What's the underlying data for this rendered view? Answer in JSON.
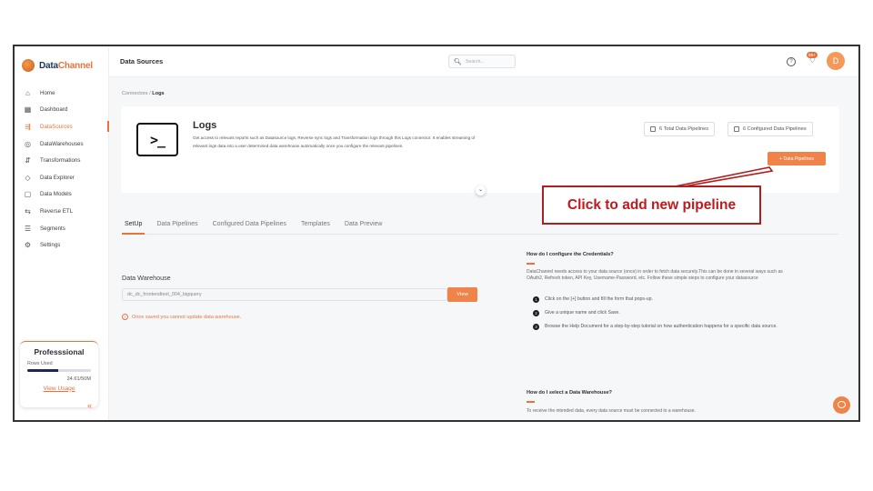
{
  "brand": {
    "name_a": "Data",
    "name_b": "Channel"
  },
  "sidebar": {
    "items": [
      {
        "label": "Home",
        "icon": "home-icon",
        "glyph": "⌂"
      },
      {
        "label": "Dashboard",
        "icon": "dashboard-icon",
        "glyph": "▦"
      },
      {
        "label": "DataSources",
        "icon": "datasources-icon",
        "glyph": "⇶",
        "active": true
      },
      {
        "label": "DataWarehouses",
        "icon": "datawarehouses-icon",
        "glyph": "◎"
      },
      {
        "label": "Transformations",
        "icon": "transformations-icon",
        "glyph": "⇵"
      },
      {
        "label": "Data Explorer",
        "icon": "data-explorer-icon",
        "glyph": "◇"
      },
      {
        "label": "Data Models",
        "icon": "data-models-icon",
        "glyph": "▢"
      },
      {
        "label": "Reverse ETL",
        "icon": "reverse-etl-icon",
        "glyph": "⇆"
      },
      {
        "label": "Segments",
        "icon": "segments-icon",
        "glyph": "☰"
      },
      {
        "label": "Settings",
        "icon": "settings-icon",
        "glyph": "⚙"
      }
    ],
    "plan": {
      "title": "Professsional",
      "rows_label": "Rows Used",
      "usage": "24.61/50M",
      "usage_fraction": 0.49,
      "link": "View Usage"
    },
    "collapse_glyph": "«"
  },
  "header": {
    "title": "Data Sources",
    "search_placeholder": "Search...",
    "notification_badge": "99+",
    "avatar_initial": "D"
  },
  "breadcrumb": {
    "parent": "Connectors",
    "separator": "/",
    "current": "Logs"
  },
  "connector": {
    "name": "Logs",
    "icon_text": ">_",
    "description": "Get access to relevant reports such as Datasource logs, Reverse sync logs and Transformation logs through this Logs connector. It enables streaming of relevant logs data into a user determined data warehouse automatically once you configure the relevant pipelines.",
    "total_pipelines": "6 Total Data Pipelines",
    "configured_pipelines": "6 Configured Data Pipelines",
    "add_button": "+ Data Pipelines"
  },
  "tabs": [
    {
      "label": "SetUp",
      "active": true
    },
    {
      "label": "Data Pipelines"
    },
    {
      "label": "Configured Data Pipelines"
    },
    {
      "label": "Templates"
    },
    {
      "label": "Data Preview"
    }
  ],
  "setup": {
    "warehouse_label": "Data Warehouse",
    "warehouse_value": "dc_dc_frontendtest_004_bigquery",
    "view_button": "View",
    "warning": "Once saved you cannot update data warehouse."
  },
  "faq": {
    "q1": "How do I configure the Credentials?",
    "a1": "DataChannel needs access to your data source (once) in order to fetch data securely.This can be done in several ways such as OAuth2, Refresh token, API Key, Username-Password, etc. Follow these simple steps to configure your datasource",
    "steps": [
      {
        "num": "1",
        "text": "Click on the [+] button and fill the form that pops-up."
      },
      {
        "num": "2",
        "text": "Give a unique name and click Save."
      },
      {
        "num": "3",
        "text": "Browse the Help Document for a step-by-step tutorial on how authentication happens for a specific data source."
      }
    ],
    "q2": "How do I select a Data Warehouse?",
    "a2": "To receive the intended data, every data source must be connected to a warehouse."
  },
  "annotation": {
    "text": "Click to add new pipeline",
    "color": "#c0181d"
  },
  "colors": {
    "accent": "#e8743b",
    "button": "#f0834a",
    "annotation_border": "#b21d1d"
  }
}
